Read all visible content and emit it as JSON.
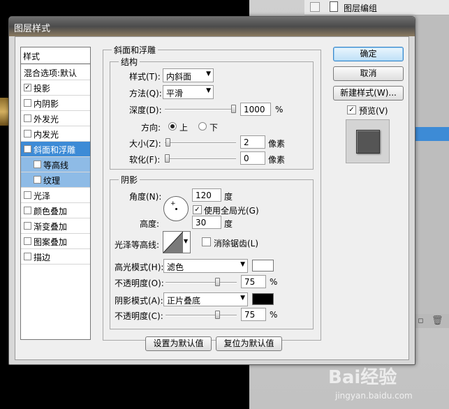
{
  "background": {
    "layers_panel_item": "图层编组",
    "watermark": "Bai经验",
    "watermark_url": "jingyan.baidu.com"
  },
  "dialog": {
    "title": "图层样式"
  },
  "style_list": {
    "header": "样式",
    "blend_options": "混合选项:默认",
    "items": [
      {
        "label": "投影",
        "checked": "✓"
      },
      {
        "label": "内阴影",
        "checked": ""
      },
      {
        "label": "外发光",
        "checked": ""
      },
      {
        "label": "内发光",
        "checked": ""
      },
      {
        "label": "斜面和浮雕",
        "checked": "✓"
      },
      {
        "label": "等高线",
        "checked": ""
      },
      {
        "label": "纹理",
        "checked": ""
      },
      {
        "label": "光泽",
        "checked": ""
      },
      {
        "label": "颜色叠加",
        "checked": ""
      },
      {
        "label": "渐变叠加",
        "checked": ""
      },
      {
        "label": "图案叠加",
        "checked": ""
      },
      {
        "label": "描边",
        "checked": ""
      }
    ]
  },
  "bevel": {
    "title": "斜面和浮雕",
    "structure": {
      "title": "结构",
      "style_label": "样式(T):",
      "style_value": "内斜面",
      "technique_label": "方法(Q):",
      "technique_value": "平滑",
      "depth_label": "深度(D):",
      "depth_value": "1000",
      "depth_unit": "%",
      "depth_level": 1.0,
      "direction_label": "方向:",
      "direction_up": "上",
      "direction_down": "下",
      "direction_selected": "上",
      "size_label": "大小(Z):",
      "size_value": "2",
      "size_unit": "像素",
      "size_level": 0.008,
      "soften_label": "软化(F):",
      "soften_value": "0",
      "soften_unit": "像素",
      "soften_level": 0.0
    },
    "shading": {
      "title": "阴影",
      "angle_label": "角度(N):",
      "angle_value": "120",
      "angle_unit": "度",
      "global_light_label": "使用全局光(G)",
      "global_light_checked": "✓",
      "altitude_label": "高度:",
      "altitude_value": "30",
      "altitude_unit": "度",
      "gloss_contour_label": "光泽等高线:",
      "anti_aliased_label": "消除锯齿(L)",
      "anti_aliased_checked": "",
      "highlight_mode_label": "高光模式(H):",
      "highlight_mode_value": "滤色",
      "highlight_color": "#ffffff",
      "highlight_opacity_label": "不透明度(O):",
      "highlight_opacity_value": "75",
      "highlight_opacity_unit": "%",
      "highlight_opacity_level": 0.75,
      "shadow_mode_label": "阴影模式(A):",
      "shadow_mode_value": "正片叠底",
      "shadow_color": "#000000",
      "shadow_opacity_label": "不透明度(C):",
      "shadow_opacity_value": "75",
      "shadow_opacity_unit": "%",
      "shadow_opacity_level": 0.75
    },
    "make_default": "设置为默认值",
    "reset_default": "复位为默认值"
  },
  "buttons": {
    "ok": "确定",
    "cancel": "取消",
    "new_style": "新建样式(W)...",
    "preview_label": "预览(V)",
    "preview_checked": "✓"
  }
}
